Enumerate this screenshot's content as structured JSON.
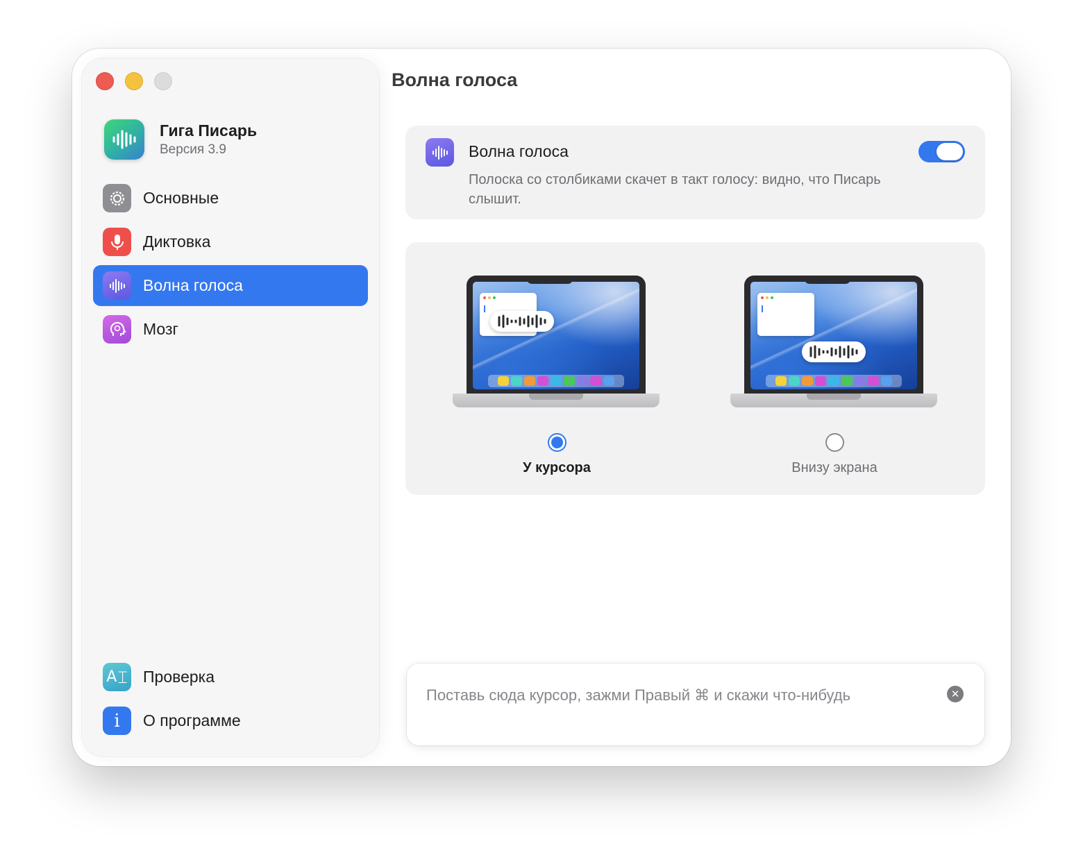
{
  "app": {
    "name": "Гига Писарь",
    "version": "Версия 3.9"
  },
  "sidebar": {
    "items": [
      {
        "label": "Основные",
        "icon": "gear-icon"
      },
      {
        "label": "Диктовка",
        "icon": "microphone-icon"
      },
      {
        "label": "Волна голоса",
        "icon": "waveform-icon",
        "active": true
      },
      {
        "label": "Мозг",
        "icon": "brain-head-icon"
      }
    ],
    "bottom_items": [
      {
        "label": "Проверка",
        "icon": "text-cursor-icon",
        "icon_text": "A"
      },
      {
        "label": "О программе",
        "icon": "info-icon",
        "icon_text": "i"
      }
    ]
  },
  "main": {
    "title": "Волна голоса",
    "setting": {
      "title": "Волна голоса",
      "description": "Полоска со столбиками скачет в такт голосу: видно, что Писарь слышит.",
      "enabled": true
    },
    "position": {
      "options": [
        {
          "label": "У курсора",
          "selected": true
        },
        {
          "label": "Внизу экрана",
          "selected": false
        }
      ]
    },
    "test_input": {
      "placeholder": "Поставь сюда курсор, зажми Правый ⌘ и скажи что-нибудь",
      "value": ""
    }
  },
  "colors": {
    "accent": "#3478f0",
    "close": "#ee5b52",
    "minimize": "#f5c23e",
    "zoom_disabled": "#dcdcdc"
  }
}
